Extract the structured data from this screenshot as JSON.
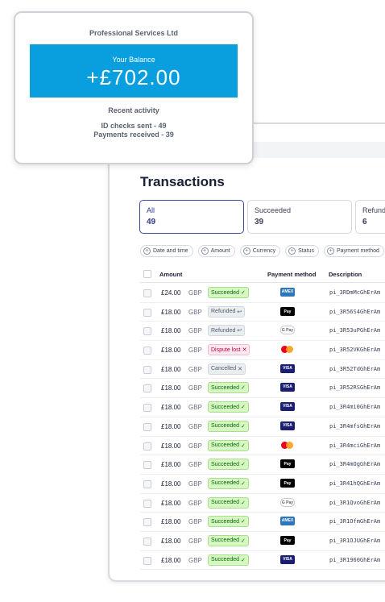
{
  "card": {
    "company": "Professional Services Ltd",
    "balance_label": "Your Balance",
    "balance_amount": "+£702.00",
    "recent_label": "Recent activity",
    "stat_id_checks": "ID checks sent - 49",
    "stat_payments": "Payments received - 39"
  },
  "dashboard": {
    "title": "Transactions",
    "tabs": [
      {
        "label": "All",
        "count": "49"
      },
      {
        "label": "Succeeded",
        "count": "39"
      },
      {
        "label": "Refund",
        "count": "6"
      }
    ],
    "filters": [
      "Date and time",
      "Amount",
      "Currency",
      "Status",
      "Payment method"
    ],
    "columns": {
      "amount": "Amount",
      "payment_method": "Payment method",
      "description": "Description"
    },
    "rows": [
      {
        "amount": "£24.00",
        "currency": "GBP",
        "status": "Succeeded",
        "status_icon": "✓",
        "pm": "amex",
        "pm_label": "AMEX",
        "desc": "pi_3RDmMcGhErAm"
      },
      {
        "amount": "£18.00",
        "currency": "GBP",
        "status": "Refunded",
        "status_icon": "↩",
        "pm": "apple",
        "pm_label": "Pay",
        "desc": "pi_3R56S4GhErAm"
      },
      {
        "amount": "£18.00",
        "currency": "GBP",
        "status": "Refunded",
        "status_icon": "↩",
        "pm": "gpay",
        "pm_label": "G Pay",
        "desc": "pi_3R53uPGhErAm"
      },
      {
        "amount": "£18.00",
        "currency": "GBP",
        "status": "Dispute lost",
        "status_icon": "✕",
        "pm": "mc",
        "pm_label": "",
        "desc": "pi_3R52VKGhErAm"
      },
      {
        "amount": "£18.00",
        "currency": "GBP",
        "status": "Cancelled",
        "status_icon": "✕",
        "pm": "visa",
        "pm_label": "VISA",
        "desc": "pi_3R52TdGhErAm"
      },
      {
        "amount": "£18.00",
        "currency": "GBP",
        "status": "Succeeded",
        "status_icon": "✓",
        "pm": "visa",
        "pm_label": "VISA",
        "desc": "pi_3R52RSGhErAm"
      },
      {
        "amount": "£18.00",
        "currency": "GBP",
        "status": "Succeeded",
        "status_icon": "✓",
        "pm": "visa",
        "pm_label": "VISA",
        "desc": "pi_3R4mi0GhErAm"
      },
      {
        "amount": "£18.00",
        "currency": "GBP",
        "status": "Succeeded",
        "status_icon": "✓",
        "pm": "visa",
        "pm_label": "VISA",
        "desc": "pi_3R4mfsGhErAm"
      },
      {
        "amount": "£18.00",
        "currency": "GBP",
        "status": "Succeeded",
        "status_icon": "✓",
        "pm": "mc",
        "pm_label": "",
        "desc": "pi_3R4mciGhErAm"
      },
      {
        "amount": "£18.00",
        "currency": "GBP",
        "status": "Succeeded",
        "status_icon": "✓",
        "pm": "apple",
        "pm_label": "Pay",
        "desc": "pi_3R4mOgGhErAm"
      },
      {
        "amount": "£18.00",
        "currency": "GBP",
        "status": "Succeeded",
        "status_icon": "✓",
        "pm": "apple",
        "pm_label": "Pay",
        "desc": "pi_3R41hQGhErAm"
      },
      {
        "amount": "£18.00",
        "currency": "GBP",
        "status": "Succeeded",
        "status_icon": "✓",
        "pm": "gpay",
        "pm_label": "G Pay",
        "desc": "pi_3R1QvoGhErAm"
      },
      {
        "amount": "£18.00",
        "currency": "GBP",
        "status": "Succeeded",
        "status_icon": "✓",
        "pm": "amex",
        "pm_label": "AMEX",
        "desc": "pi_3R1OfmGhErAm"
      },
      {
        "amount": "£18.00",
        "currency": "GBP",
        "status": "Succeeded",
        "status_icon": "✓",
        "pm": "apple",
        "pm_label": "Pay",
        "desc": "pi_3R1OJUGhErAm"
      },
      {
        "amount": "£18.00",
        "currency": "GBP",
        "status": "Succeeded",
        "status_icon": "✓",
        "pm": "visa",
        "pm_label": "VISA",
        "desc": "pi_3R1960GhErAm"
      }
    ]
  }
}
